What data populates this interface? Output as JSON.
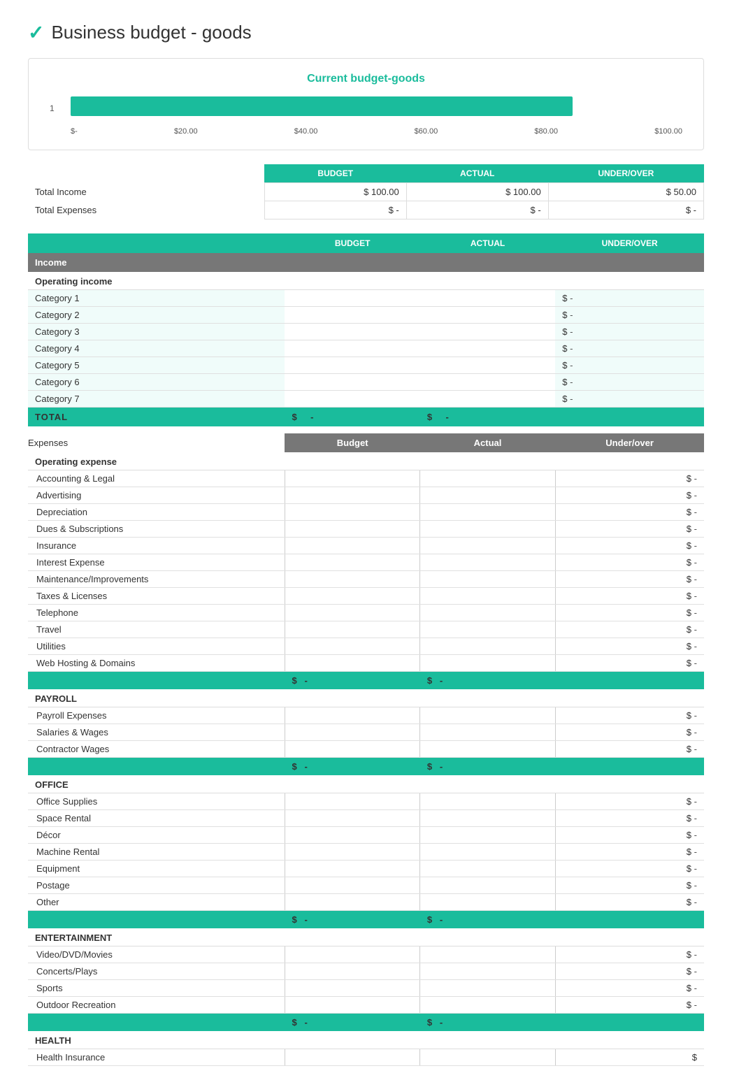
{
  "page": {
    "title": "Business budget - goods",
    "logo_symbol": "✓"
  },
  "chart": {
    "title": "Current budget-goods",
    "x_labels": [
      "$-",
      "$20.00",
      "$40.00",
      "$60.00",
      "$80.00",
      "$100.00"
    ],
    "bar_width_percent": 82,
    "y_label": "1"
  },
  "summary": {
    "headers": [
      "BUDGET",
      "ACTUAL",
      "UNDER/OVER"
    ],
    "rows": [
      {
        "label": "Total Income",
        "budget": "$ 100.00",
        "actual": "$ 100.00",
        "under_over": "$ 50.00"
      },
      {
        "label": "Total Expenses",
        "budget": "$  -",
        "actual": "$  -",
        "under_over": "$  -"
      }
    ]
  },
  "income_section": {
    "section_label": "Income",
    "headers": [
      "BUDGET",
      "ACTUAL",
      "UNDER/OVER"
    ],
    "subsection_label": "Operating income",
    "categories": [
      "Category 1",
      "Category 2",
      "Category 3",
      "Category 4",
      "Category 5",
      "Category 6",
      "Category 7"
    ],
    "total_label": "TOTAL"
  },
  "expenses_section": {
    "section_label": "Expenses",
    "budget_header": "Budget",
    "actual_header": "Actual",
    "under_header": "Under/over",
    "operating": {
      "subsection": "Operating expense",
      "items": [
        "Accounting & Legal",
        "Advertising",
        "Depreciation",
        "Dues & Subscriptions",
        "Insurance",
        "Interest Expense",
        "Maintenance/Improvements",
        "Taxes & Licenses",
        "Telephone",
        "Travel",
        "Utilities",
        "Web Hosting & Domains"
      ]
    },
    "payroll": {
      "subsection": "PAYROLL",
      "items": [
        "Payroll Expenses",
        "Salaries & Wages",
        "Contractor Wages"
      ]
    },
    "office": {
      "subsection": "OFFICE",
      "items": [
        "Office Supplies",
        "Space Rental",
        "Décor",
        "Machine Rental",
        "Equipment",
        "Postage",
        "Other"
      ]
    },
    "entertainment": {
      "subsection": "ENTERTAINMENT",
      "items": [
        "Video/DVD/Movies",
        "Concerts/Plays",
        "Sports",
        "Outdoor Recreation"
      ]
    },
    "health": {
      "subsection": "HEALTH",
      "items": [
        "Health Insurance"
      ]
    }
  },
  "dash": "-"
}
